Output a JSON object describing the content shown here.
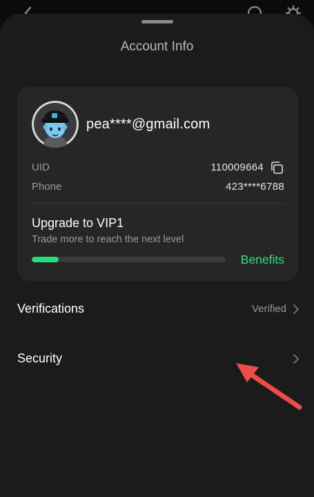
{
  "header": {
    "title": "Account Info"
  },
  "account": {
    "email": "pea****@gmail.com",
    "uid_label": "UID",
    "uid_value": "110009664",
    "phone_label": "Phone",
    "phone_value": "423****6788"
  },
  "vip": {
    "title": "Upgrade to VIP1",
    "subtitle": "Trade more to reach the next level",
    "progress_fraction": 0.14,
    "benefits_label": "Benefits"
  },
  "menu": {
    "items": [
      {
        "label": "Verifications",
        "status": "Verified"
      },
      {
        "label": "Security",
        "status": ""
      }
    ]
  },
  "colors": {
    "accent": "#1fe07a",
    "annotation_arrow": "#ef4b47"
  },
  "icons": [
    "back-arrow-icon",
    "headset-icon",
    "gear-icon",
    "copy-icon",
    "chevron-right-icon"
  ]
}
